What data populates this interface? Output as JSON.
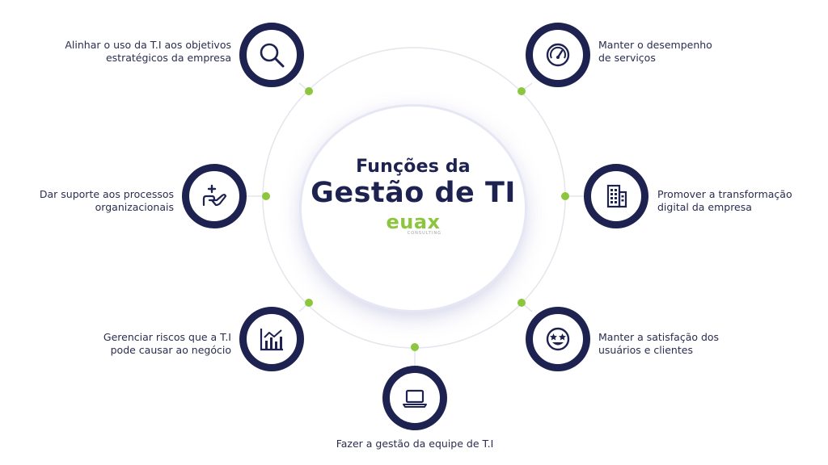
{
  "center": {
    "title_line1": "Funções da",
    "title_line2": "Gestão de TI",
    "logo_text": "euax",
    "logo_subtext": "CONSULTING"
  },
  "functions": [
    {
      "id": "align",
      "label_line1": "Alinhar o uso da T.I aos objetivos",
      "label_line2": "estratégicos da empresa",
      "icon": "magnifier-icon"
    },
    {
      "id": "performance",
      "label_line1": "Manter o desempenho",
      "label_line2": "de serviços",
      "icon": "speedometer-icon"
    },
    {
      "id": "support",
      "label_line1": "Dar suporte aos processos",
      "label_line2": "organizacionais",
      "icon": "hand-plus-icon"
    },
    {
      "id": "digital",
      "label_line1": "Promover a transformação",
      "label_line2": "digital da empresa",
      "icon": "building-icon"
    },
    {
      "id": "risks",
      "label_line1": "Gerenciar riscos que a T.I",
      "label_line2": "pode causar ao negócio",
      "icon": "chart-icon"
    },
    {
      "id": "satisfaction",
      "label_line1": "Manter a satisfação dos",
      "label_line2": "usuários e clientes",
      "icon": "star-eyes-face-icon"
    },
    {
      "id": "team",
      "label_line1": "Fazer a gestão da equipe de T.I",
      "label_line2": "",
      "icon": "laptop-icon"
    }
  ],
  "colors": {
    "navy": "#1e2250",
    "green": "#8cc63f",
    "ring": "#e3e4ee"
  }
}
